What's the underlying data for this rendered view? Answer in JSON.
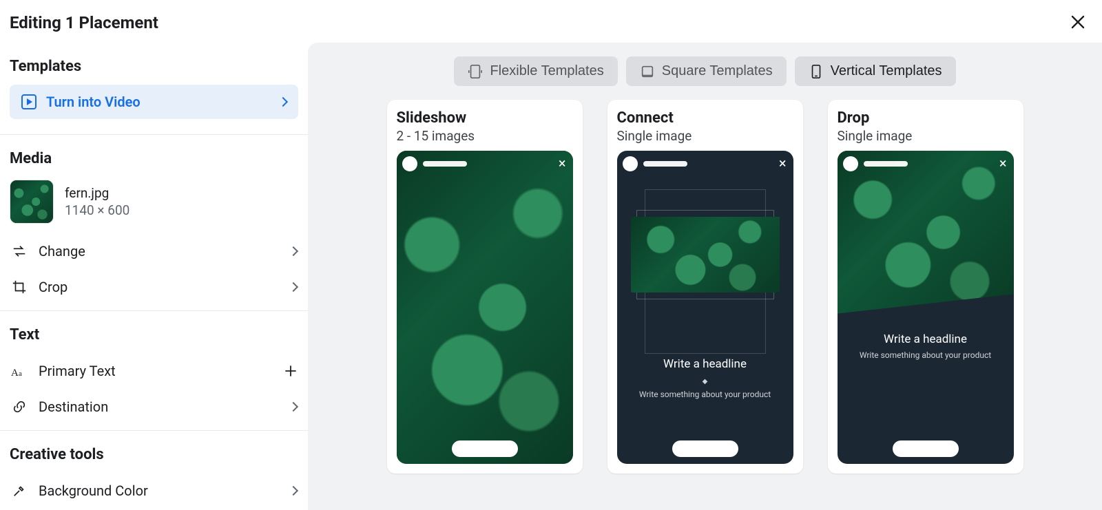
{
  "header": {
    "title": "Editing 1 Placement"
  },
  "sidebar": {
    "templates": {
      "title": "Templates",
      "turn_into_video": "Turn into Video"
    },
    "media": {
      "title": "Media",
      "filename": "fern.jpg",
      "dimensions": "1140 × 600",
      "change": "Change",
      "crop": "Crop"
    },
    "text": {
      "title": "Text",
      "primary": "Primary Text",
      "destination": "Destination"
    },
    "creative_tools": {
      "title": "Creative tools",
      "bg_color": "Background Color"
    }
  },
  "tabs": {
    "flexible": "Flexible Templates",
    "square": "Square Templates",
    "vertical": "Vertical Templates",
    "selected": "vertical"
  },
  "cards": [
    {
      "title": "Slideshow",
      "subtitle": "2 - 15 images"
    },
    {
      "title": "Connect",
      "subtitle": "Single image",
      "headline": "Write a headline",
      "body": "Write something about your product"
    },
    {
      "title": "Drop",
      "subtitle": "Single image",
      "headline": "Write a headline",
      "body": "Write something about your product"
    }
  ]
}
